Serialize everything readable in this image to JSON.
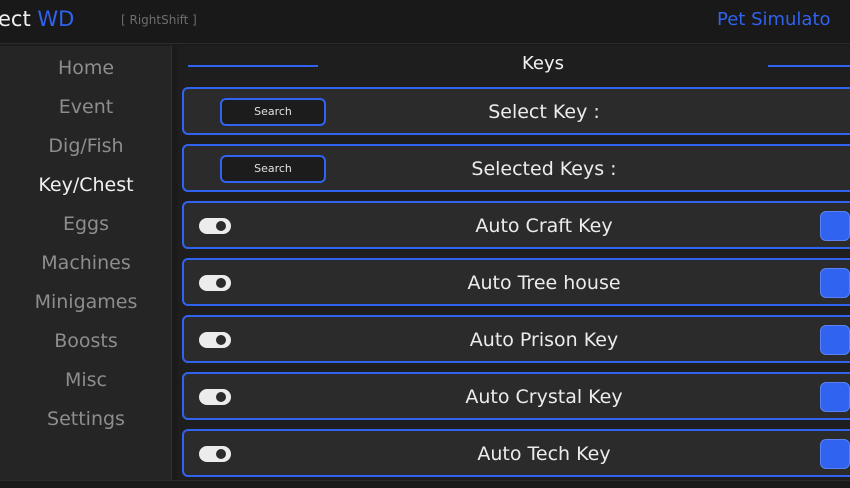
{
  "window": {
    "title_prefix": "ect ",
    "title_accent": "WD",
    "hotkey": "[ RightShift ]",
    "game_name": "Pet Simulato"
  },
  "sidebar": {
    "items": [
      {
        "label": "Home"
      },
      {
        "label": "Event"
      },
      {
        "label": "Dig/Fish"
      },
      {
        "label": "Key/Chest",
        "active": true
      },
      {
        "label": "Eggs"
      },
      {
        "label": "Machines"
      },
      {
        "label": "Minigames"
      },
      {
        "label": "Boosts"
      },
      {
        "label": "Misc"
      },
      {
        "label": "Settings"
      }
    ]
  },
  "main": {
    "section_title": "Keys",
    "dropdowns": [
      {
        "search_label": "Search",
        "label": "Select Key :"
      },
      {
        "search_label": "Search",
        "label": "Selected Keys :"
      }
    ],
    "toggles": [
      {
        "label": "Auto Craft Key",
        "enabled": true
      },
      {
        "label": "Auto Tree house",
        "enabled": true
      },
      {
        "label": "Auto Prison Key",
        "enabled": true
      },
      {
        "label": "Auto Crystal Key",
        "enabled": true
      },
      {
        "label": "Auto Tech Key",
        "enabled": true
      }
    ]
  },
  "colors": {
    "accent": "#2f63f0",
    "background": "#1e1e1e",
    "row_background": "#2b2b2b",
    "sidebar_background": "#252525"
  }
}
